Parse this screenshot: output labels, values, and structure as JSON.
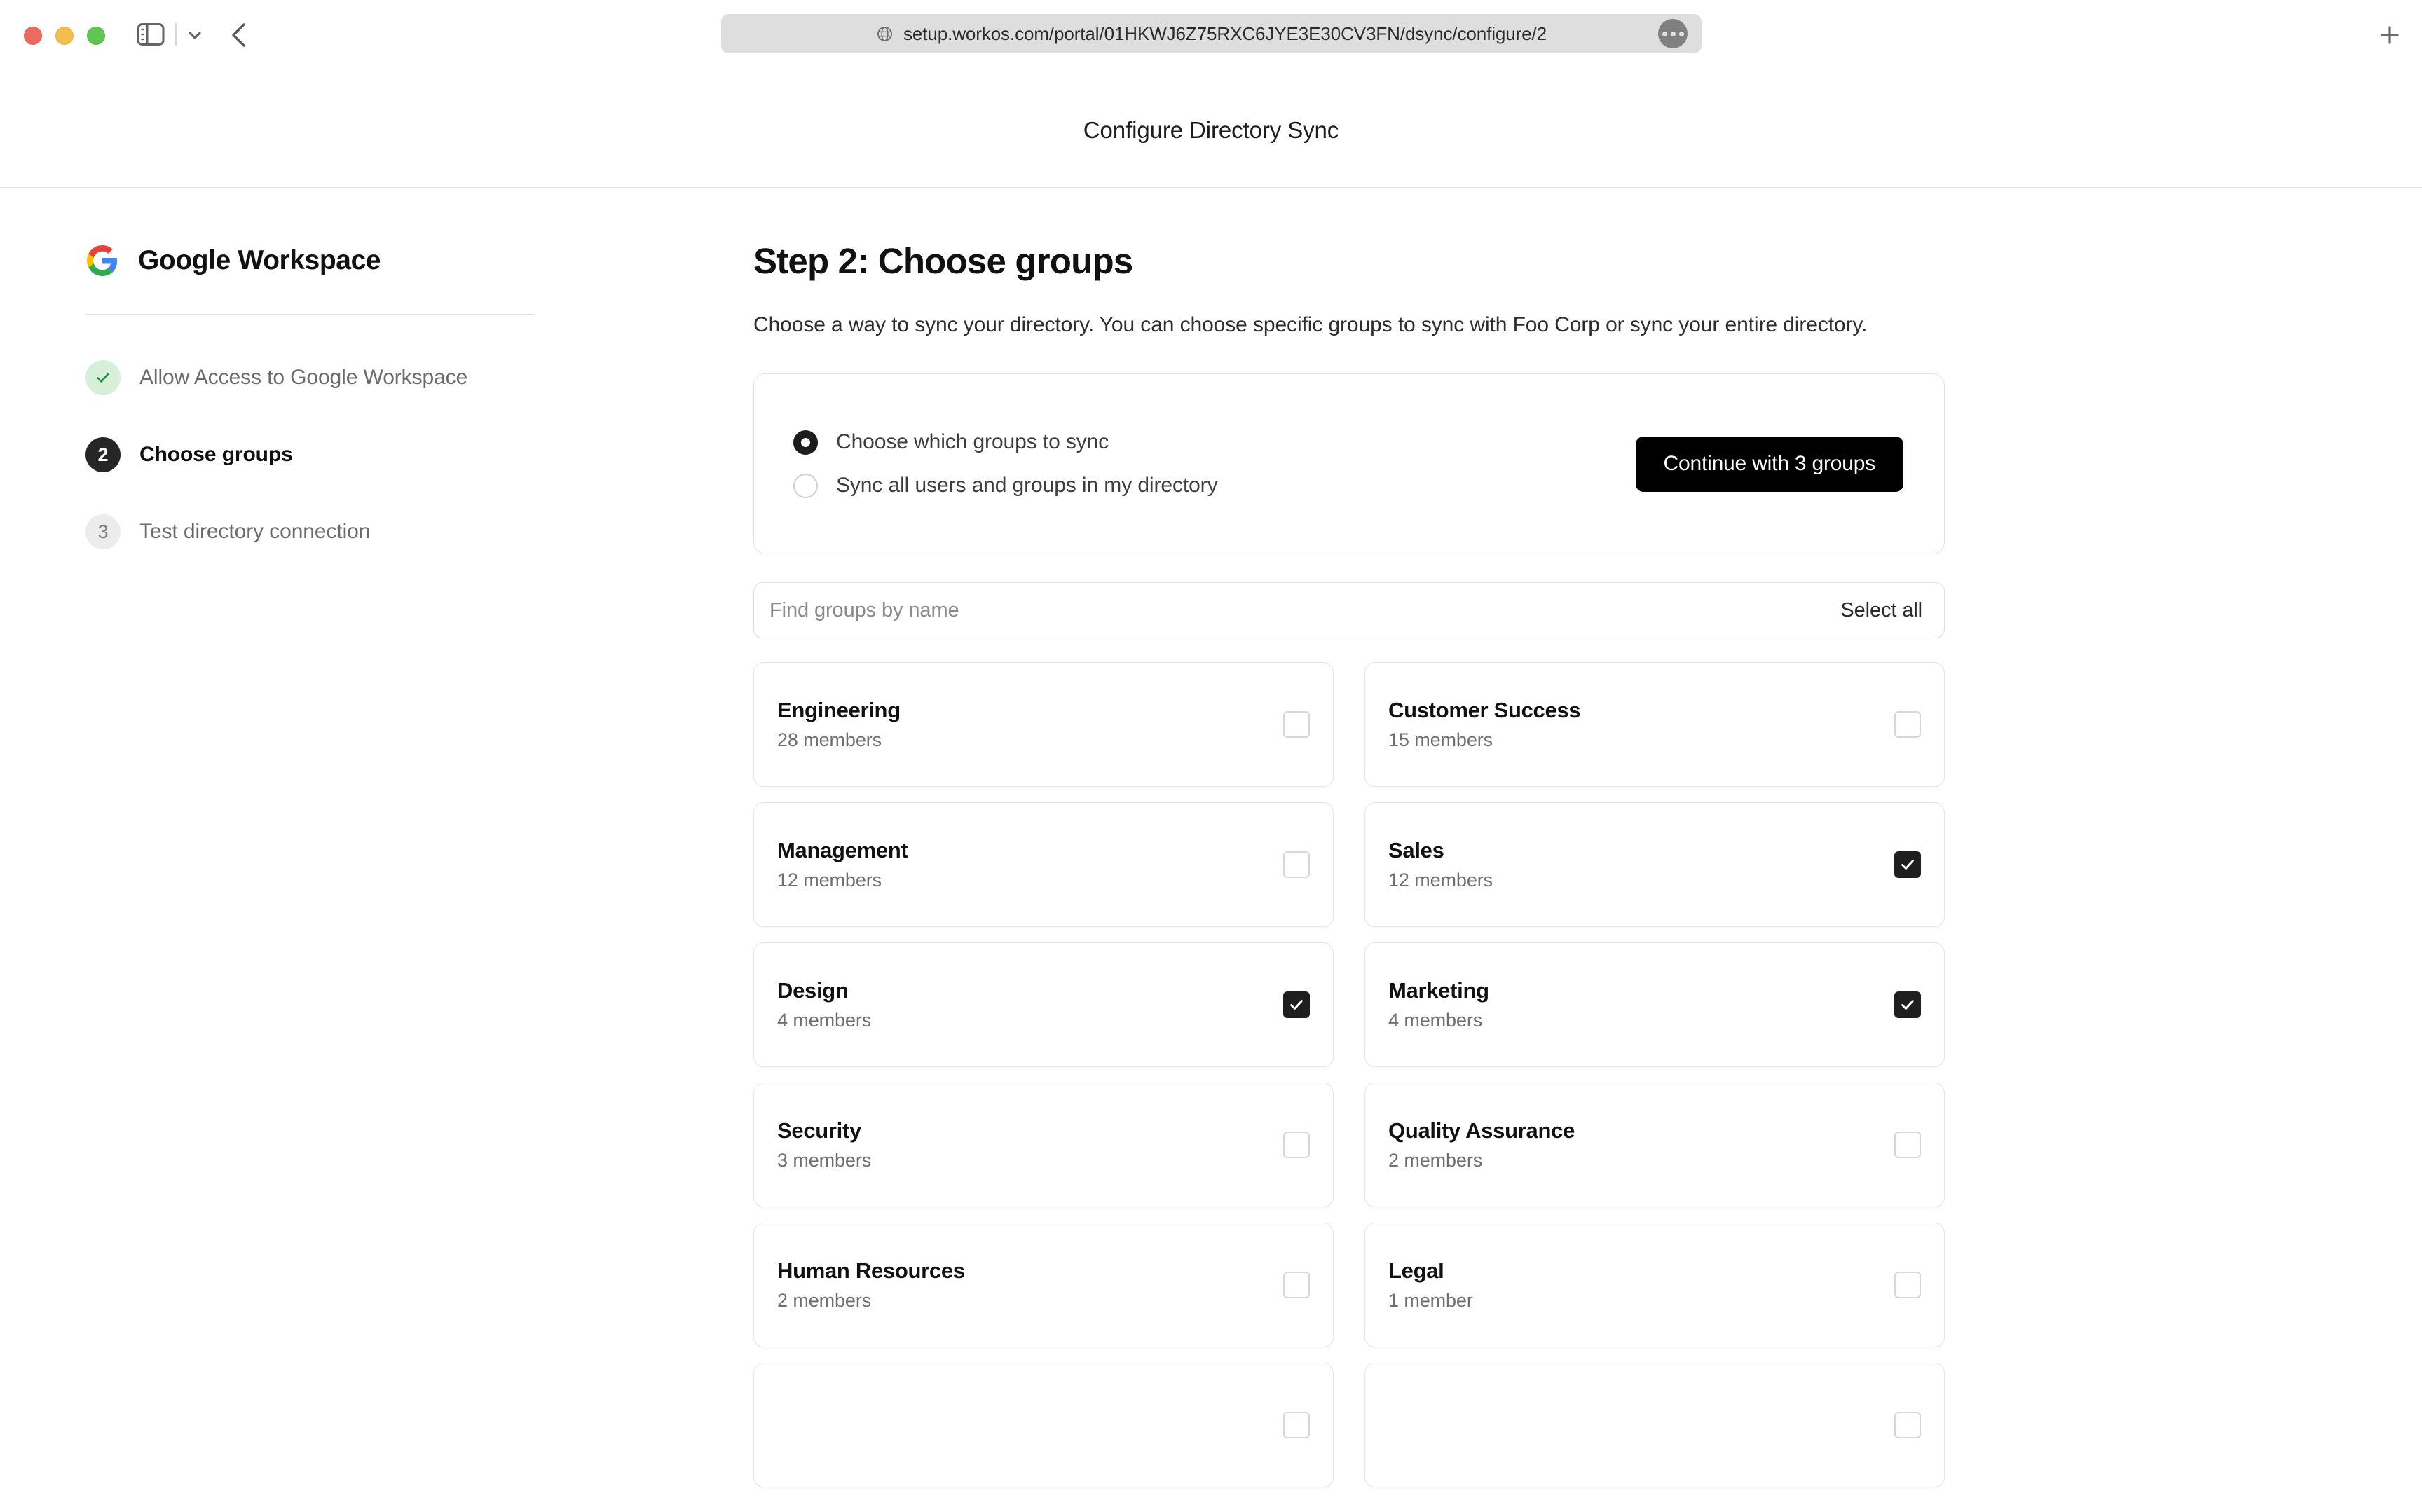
{
  "browser": {
    "window_controls": [
      "close",
      "minimize",
      "maximize"
    ],
    "sidebar_toggle_icon": "sidebar-icon",
    "chevron_icon": "chevron-down-icon",
    "back_icon": "back-arrow-icon",
    "url": "setup.workos.com/portal/01HKWJ6Z75RXC6JYE3E30CV3FN/dsync/configure/2",
    "url_lock_icon": "globe-icon",
    "url_more_icon": "more-dots-icon",
    "new_tab_icon": "plus-icon"
  },
  "page": {
    "title": "Configure Directory Sync"
  },
  "sidebar": {
    "brand": "Google Workspace",
    "brand_icon": "google-logo-icon",
    "steps": [
      {
        "badge": "✓",
        "label": "Allow Access to Google Workspace",
        "state": "done"
      },
      {
        "badge": "2",
        "label": "Choose groups",
        "state": "current"
      },
      {
        "badge": "3",
        "label": "Test directory connection",
        "state": "todo"
      }
    ]
  },
  "main": {
    "heading": "Step 2: Choose groups",
    "description": "Choose a way to sync your directory. You can choose specific groups to sync with Foo Corp or sync your entire directory.",
    "sync_options": [
      {
        "label": "Choose which groups to sync",
        "selected": true
      },
      {
        "label": "Sync all users and groups in my directory",
        "selected": false
      }
    ],
    "continue_button": "Continue with 3 groups",
    "search": {
      "placeholder": "Find groups by name",
      "value": ""
    },
    "select_all": "Select all",
    "selected_count": 3,
    "groups": [
      {
        "name": "Engineering",
        "members": "28 members",
        "checked": false
      },
      {
        "name": "Customer Success",
        "members": "15 members",
        "checked": false
      },
      {
        "name": "Management",
        "members": "12 members",
        "checked": false
      },
      {
        "name": "Sales",
        "members": "12 members",
        "checked": true
      },
      {
        "name": "Design",
        "members": "4 members",
        "checked": true
      },
      {
        "name": "Marketing",
        "members": "4 members",
        "checked": true
      },
      {
        "name": "Security",
        "members": "3 members",
        "checked": false
      },
      {
        "name": "Quality Assurance",
        "members": "2 members",
        "checked": false
      },
      {
        "name": "Human Resources",
        "members": "2 members",
        "checked": false
      },
      {
        "name": "Legal",
        "members": "1 member",
        "checked": false
      },
      {
        "name": "",
        "members": "",
        "checked": false
      },
      {
        "name": "",
        "members": "",
        "checked": false
      }
    ]
  },
  "colors": {
    "accent_black": "#000000",
    "step_done_bg": "#d5efd9",
    "step_done_check": "#2f8a43",
    "step_current_bg": "#262626",
    "step_todo_bg": "#ececec",
    "border": "#e6e6e6",
    "muted_text": "#6f6f6f"
  }
}
